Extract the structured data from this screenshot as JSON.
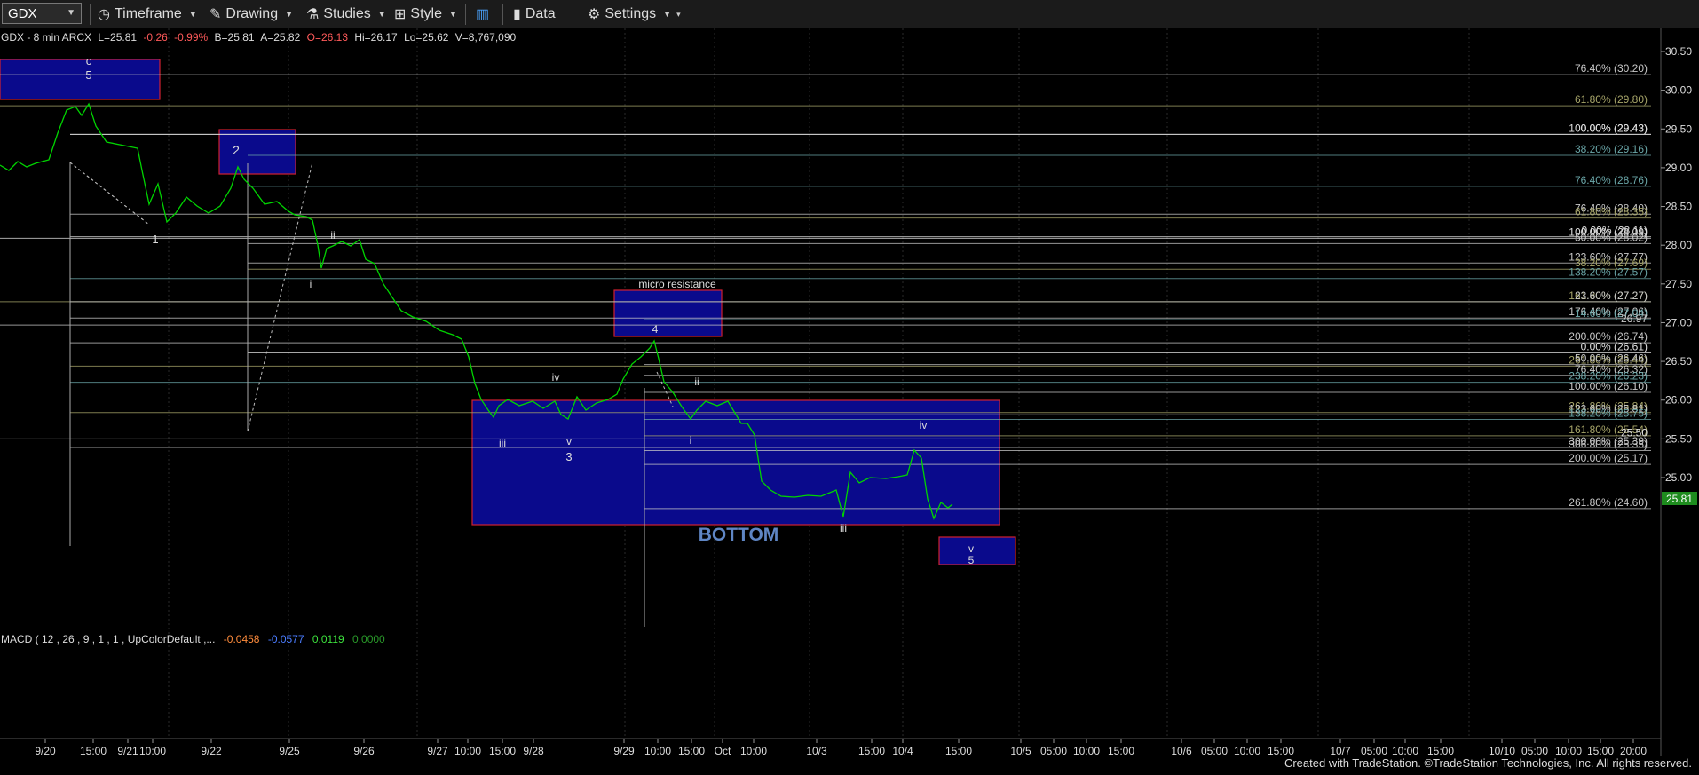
{
  "toolbar": {
    "symbol": "GDX",
    "items": [
      {
        "label": "Timeframe",
        "icon": "clock-icon"
      },
      {
        "label": "Drawing",
        "icon": "pencil-icon"
      },
      {
        "label": "Studies",
        "icon": "flask-icon"
      },
      {
        "label": "Style",
        "icon": "style-icon"
      },
      {
        "label": "",
        "icon": "panel-toggle-icon"
      },
      {
        "label": "Data",
        "icon": "bar-chart-icon"
      },
      {
        "label": "Settings",
        "icon": "gear-icon"
      }
    ]
  },
  "header": {
    "instrument": "GDX - 8 min  ARCX",
    "last": "L=25.81",
    "change": "-0.26",
    "pct": "-0.99%",
    "bid": "B=25.81",
    "ask": "A=25.82",
    "open": "O=26.13",
    "high": "Hi=26.17",
    "low": "Lo=25.62",
    "volume": "V=8,767,090"
  },
  "macd": {
    "label": "MACD ( 12 , 26 , 9 , 1 , 1 , UpColorDefault ,...",
    "v1": "-0.0458",
    "v2": "-0.0577",
    "v3": "0.0119",
    "v4": "0.0000"
  },
  "price_axis": {
    "ticks": [
      "30.50",
      "30.00",
      "29.50",
      "29.00",
      "28.50",
      "28.00",
      "27.50",
      "27.00",
      "26.50",
      "26.00",
      "25.50",
      "25.00"
    ],
    "last_price": "25.81"
  },
  "time_axis": {
    "labels": [
      "9/20",
      "15:00",
      "9/21",
      "10:00",
      "9/22",
      "9/25",
      "9/26",
      "9/27",
      "10:00",
      "15:00",
      "9/28",
      "9/29",
      "10:00",
      "15:00",
      "Oct",
      "10:00",
      "10/3",
      "15:00",
      "10/4",
      "15:00",
      "10/5",
      "05:00",
      "10:00",
      "15:00",
      "10/6",
      "05:00",
      "10:00",
      "15:00",
      "10/7",
      "05:00",
      "10:00",
      "15:00",
      "10/10",
      "05:00",
      "10:00",
      "15:00",
      "20:00"
    ]
  },
  "fib_labels": [
    "76.40% (30.20)",
    "61.80% (29.80)",
    "100.00% (29.43)",
    "0.00% (29.43)",
    "38.20% (29.16)",
    "76.40% (28.76)",
    "76.40% (28.40)",
    "61.80% (28.35)",
    "0.00% (28.11)",
    "100.00% (28.09)",
    "50.00% (28.02)",
    "123.60% (27.77)",
    "38.20% (27.69)",
    "138.20% (27.57)",
    "161.80% (27.27)",
    "23.60% (27.27)",
    "176.40% (27.06)",
    "14.60% (27.04)",
    "26.97",
    "200.00% (26.74)",
    "0.00% (26.61)",
    "261.80% (26.44)",
    "50.00% (26.46)",
    "76.40% (26.32)",
    "238.20% (26.23)",
    "100.00% (26.10)",
    "261.80% (25.84)",
    "123.60% (25.81)",
    "138.20% (25.75)",
    "161.80% (25.54)",
    "25.50",
    "300.00% (25.39)",
    "306.80% (25.35)",
    "200.00% (25.17)",
    "261.80% (24.60)"
  ],
  "annotations": {
    "box_c": "c",
    "box_c_5": "5",
    "box_2": "2",
    "micro_resistance": "micro resistance",
    "box_4": "4",
    "bottom": "BOTTOM",
    "box_v": "v",
    "box_v_5": "5",
    "wave_1": "1",
    "wave_i_a": "i",
    "wave_ii_a": "ii",
    "wave_iii_a": "iii",
    "wave_iv_a": "iv",
    "wave_v_a": "v",
    "wave_3": "3",
    "wave_i_b": "i",
    "wave_ii_b": "ii",
    "wave_iii_b": "iii",
    "wave_iv_b": "iv"
  },
  "footer": {
    "credit": "Created with TradeStation. ©TradeStation Technologies, Inc. All rights reserved."
  },
  "colors": {
    "price_line": "#00d400",
    "box_fill": "#0a0a8c",
    "box_border": "#d02030",
    "fib_label": "#d8d8d8",
    "last_price_tag": "#1e8c1e"
  }
}
